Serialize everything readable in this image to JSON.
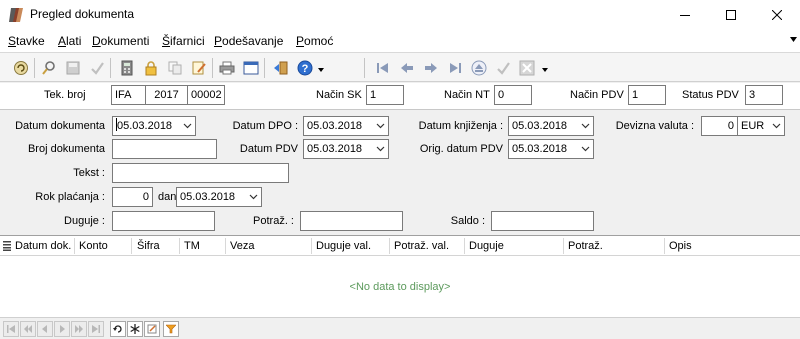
{
  "window": {
    "title": "Pregled dokumenta"
  },
  "menu": {
    "items": [
      "Stavke",
      "Alati",
      "Dokumenti",
      "Šifarnici",
      "Podešavanje",
      "Pomoć"
    ]
  },
  "header": {
    "tek_broj_label": "Tek. broj",
    "tek_broj": [
      "IFA",
      "2017",
      "00002"
    ],
    "nacin_sk_label": "Način SK",
    "nacin_sk": "1",
    "nacin_nt_label": "Način NT",
    "nacin_nt": "0",
    "nacin_pdv_label": "Način PDV",
    "nacin_pdv": "1",
    "status_pdv_label": "Status PDV",
    "status_pdv": "3"
  },
  "form": {
    "datum_dokumenta_label": "Datum dokumenta",
    "datum_dokumenta": "05.03.2018",
    "datum_dpo_label": "Datum DPO :",
    "datum_dpo": "05.03.2018",
    "datum_knjizenja_label": "Datum knjiženja :",
    "datum_knjizenja": "05.03.2018",
    "devizna_valuta_label": "Devizna valuta :",
    "devizna_valuta_iznos": "0",
    "devizna_valuta": "EUR",
    "broj_dokumenta_label": "Broj dokumenta",
    "broj_dokumenta": "",
    "datum_pdv_label": "Datum PDV",
    "datum_pdv": "05.03.2018",
    "orig_datum_pdv_label": "Orig. datum PDV",
    "orig_datum_pdv": "05.03.2018",
    "tekst_label": "Tekst :",
    "tekst": "",
    "rok_placanja_label": "Rok plaćanja :",
    "rok_placanja": "0",
    "dan_label": "dan",
    "rok_datum": "05.03.2018",
    "duguje_label": "Duguje :",
    "duguje": "",
    "potraz_label": "Potraž. :",
    "potraz": "",
    "saldo_label": "Saldo :",
    "saldo": ""
  },
  "grid": {
    "columns": [
      "Datum dok.",
      "Konto",
      "Šifra",
      "TM",
      "Veza",
      "Duguje val.",
      "Potraž. val.",
      "Duguje",
      "Potraž.",
      "Opis"
    ],
    "empty_text": "<No data to display>"
  }
}
